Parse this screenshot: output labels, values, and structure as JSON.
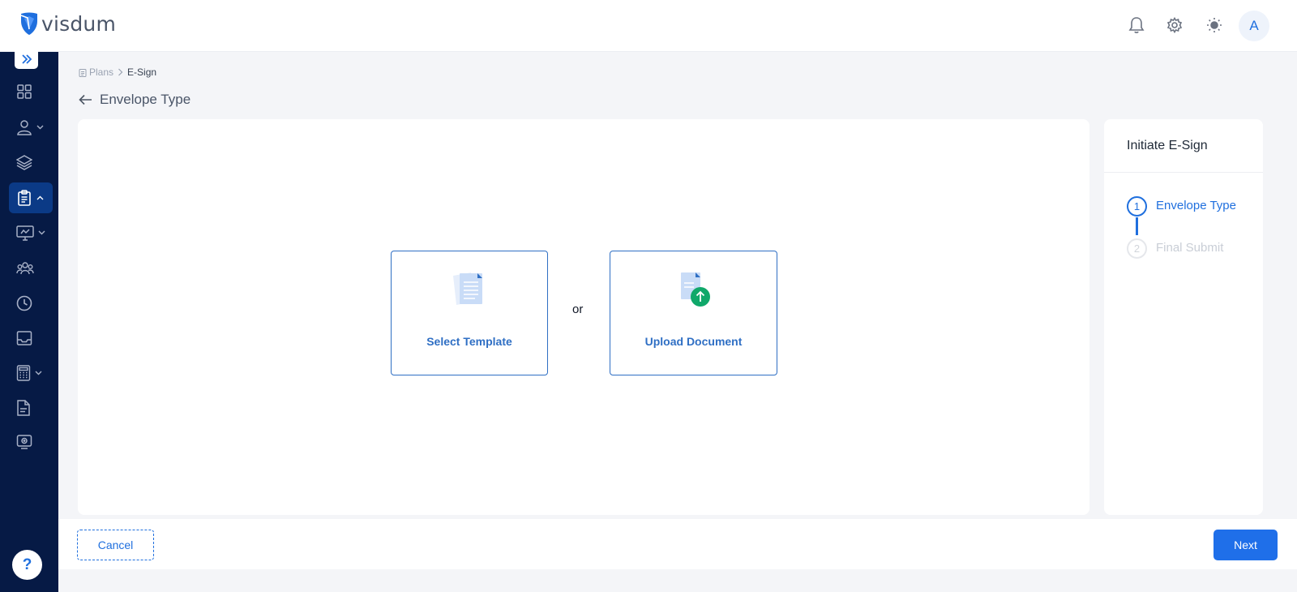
{
  "app": {
    "logo_text": "visdum",
    "avatar_initial": "A"
  },
  "header": {
    "icons": [
      "bell-icon",
      "gear-icon",
      "sun-icon"
    ]
  },
  "sidebar": {
    "items": [
      {
        "icon": "dashboard-icon",
        "has_chevron": false
      },
      {
        "icon": "user-icon",
        "has_chevron": true
      },
      {
        "icon": "layers-icon",
        "has_chevron": false
      },
      {
        "icon": "clipboard-icon",
        "has_chevron": true,
        "active": true
      },
      {
        "icon": "monitor-icon",
        "has_chevron": true
      },
      {
        "icon": "team-icon",
        "has_chevron": false
      },
      {
        "icon": "clock-icon",
        "has_chevron": false
      },
      {
        "icon": "inbox-icon",
        "has_chevron": false
      },
      {
        "icon": "calculator-icon",
        "has_chevron": true
      },
      {
        "icon": "document-icon",
        "has_chevron": false
      },
      {
        "icon": "media-icon",
        "has_chevron": false
      }
    ],
    "help_label": "?"
  },
  "breadcrumb": {
    "parent": "Plans",
    "current": "E-Sign"
  },
  "page": {
    "title": "Envelope Type"
  },
  "options": {
    "select_template": "Select Template",
    "or": "or",
    "upload_document": "Upload Document"
  },
  "steps": {
    "title": "Initiate E-Sign",
    "items": [
      {
        "number": "1",
        "label": "Envelope Type"
      },
      {
        "number": "2",
        "label": "Final Submit"
      }
    ]
  },
  "footer": {
    "cancel_label": "Cancel",
    "next_label": "Next"
  },
  "colors": {
    "primary": "#1f6fde",
    "sidebar_bg": "#061a45",
    "sidebar_active": "#0b3a86",
    "upload_green": "#10a86a"
  }
}
